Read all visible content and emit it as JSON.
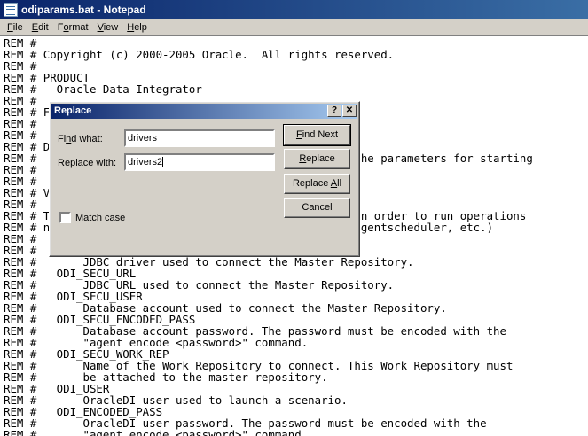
{
  "window": {
    "title": "odiparams.bat - Notepad"
  },
  "menu": [
    {
      "first": "F",
      "rest": "ile"
    },
    {
      "first": "E",
      "rest": "dit"
    },
    {
      "first": "F",
      "rest": "ormat",
      "pre": "F",
      "underline": "o",
      "post": "rmat"
    },
    {
      "first": "V",
      "rest": "iew"
    },
    {
      "first": "H",
      "rest": "elp"
    }
  ],
  "editor": {
    "lines": [
      "REM #",
      "REM # Copyright (c) 2000-2005 Oracle.  All rights reserved.",
      "REM #",
      "REM # PRODUCT",
      "REM #   Oracle Data Integrator",
      "REM #",
      "REM # F",
      "REM #",
      "REM #",
      "REM # D",
      "REM #                                                the parameters for starting",
      "REM #",
      "REM #",
      "REM # V",
      "REM #",
      "REM # T                                              in order to run operations",
      "REM # n                                            , agentscheduler, etc.)",
      "REM #",
      "REM #",
      "REM #       JDBC driver used to connect the Master Repository.",
      "REM #   ODI_SECU_URL",
      "REM #       JDBC URL used to connect the Master Repository.",
      "REM #   ODI_SECU_USER",
      "REM #       Database account used to connect the Master Repository.",
      "REM #   ODI_SECU_ENCODED_PASS",
      "REM #       Database account password. The password must be encoded with the",
      "REM #       \"agent encode <password>\" command.",
      "REM #   ODI_SECU_WORK_REP",
      "REM #       Name of the Work Repository to connect. This Work Repository must",
      "REM #       be attached to the master repository.",
      "REM #   ODI_USER",
      "REM #       OracleDI user used to launch a scenario.",
      "REM #   ODI_ENCODED_PASS",
      "REM #       OracleDI user password. The password must be encoded with the",
      "REM #       \"agent encode <password>\" command."
    ]
  },
  "dialog": {
    "title": "Replace",
    "help_glyph": "?",
    "close_glyph": "✕",
    "find_label_pre": "Fi",
    "find_label_u": "n",
    "find_label_post": "d what:",
    "find_value": "drivers",
    "replace_label_pre": "Re",
    "replace_label_u": "p",
    "replace_label_post": "lace with:",
    "replace_value": "drivers2",
    "match_case_pre": "Match ",
    "match_case_u": "c",
    "match_case_post": "ase",
    "find_next_u": "F",
    "find_next_rest": "ind Next",
    "replace_u": "R",
    "replace_rest": "eplace",
    "replace_all_pre": "Replace ",
    "replace_all_u": "A",
    "replace_all_post": "ll",
    "cancel_label": "Cancel"
  }
}
